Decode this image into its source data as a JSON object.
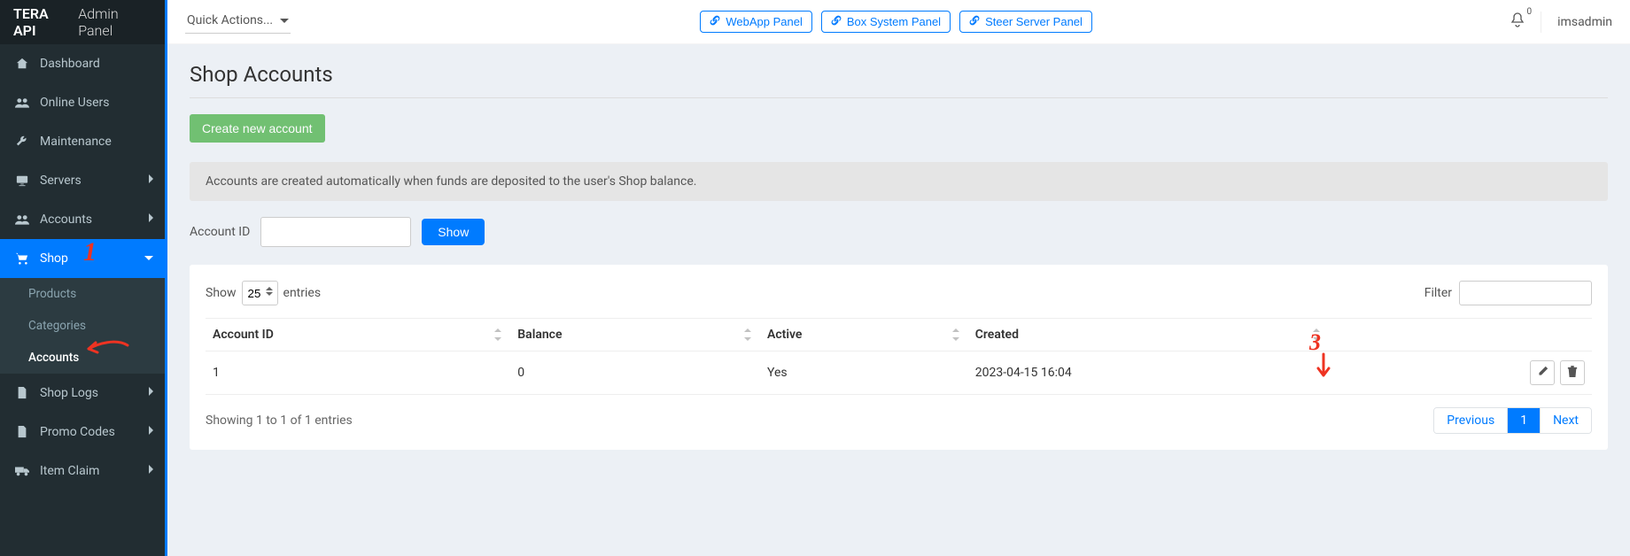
{
  "brand": {
    "bold": "TERA API",
    "thin": "Admin Panel"
  },
  "topbar": {
    "quick_actions": "Quick Actions...",
    "links": [
      {
        "label": "WebApp Panel"
      },
      {
        "label": "Box System Panel"
      },
      {
        "label": "Steer Server Panel"
      }
    ],
    "notif_count": "0",
    "username": "imsadmin"
  },
  "sidebar": {
    "items": [
      {
        "label": "Dashboard",
        "icon": "dashboard",
        "expandable": false
      },
      {
        "label": "Online Users",
        "icon": "users",
        "expandable": false
      },
      {
        "label": "Maintenance",
        "icon": "wrench",
        "expandable": false
      },
      {
        "label": "Servers",
        "icon": "desktop",
        "expandable": true
      },
      {
        "label": "Accounts",
        "icon": "users",
        "expandable": true
      },
      {
        "label": "Shop",
        "icon": "cart",
        "expandable": true,
        "active": true,
        "expanded": true
      },
      {
        "label": "Shop Logs",
        "icon": "file",
        "expandable": true
      },
      {
        "label": "Promo Codes",
        "icon": "file",
        "expandable": true
      },
      {
        "label": "Item Claim",
        "icon": "truck",
        "expandable": true
      }
    ],
    "shop_sub": [
      {
        "label": "Products"
      },
      {
        "label": "Categories"
      },
      {
        "label": "Accounts",
        "active": true
      }
    ]
  },
  "page": {
    "title": "Shop Accounts",
    "create_btn": "Create new account",
    "info": "Accounts are created automatically when funds are deposited to the user's Shop balance.",
    "lookup_label": "Account ID",
    "lookup_value": "",
    "show_btn": "Show"
  },
  "table": {
    "show_label_pre": "Show",
    "show_value": "25",
    "show_label_post": "entries",
    "filter_label": "Filter",
    "filter_value": "",
    "columns": [
      "Account ID",
      "Balance",
      "Active",
      "Created",
      ""
    ],
    "rows": [
      {
        "account_id": "1",
        "balance": "0",
        "active": "Yes",
        "created": "2023-04-15 16:04"
      }
    ],
    "showing": "Showing 1 to 1 of 1 entries",
    "pagination": {
      "prev": "Previous",
      "pages": [
        "1"
      ],
      "next": "Next",
      "current": "1"
    }
  },
  "annotations": {
    "a1": "1",
    "a3": "3"
  }
}
